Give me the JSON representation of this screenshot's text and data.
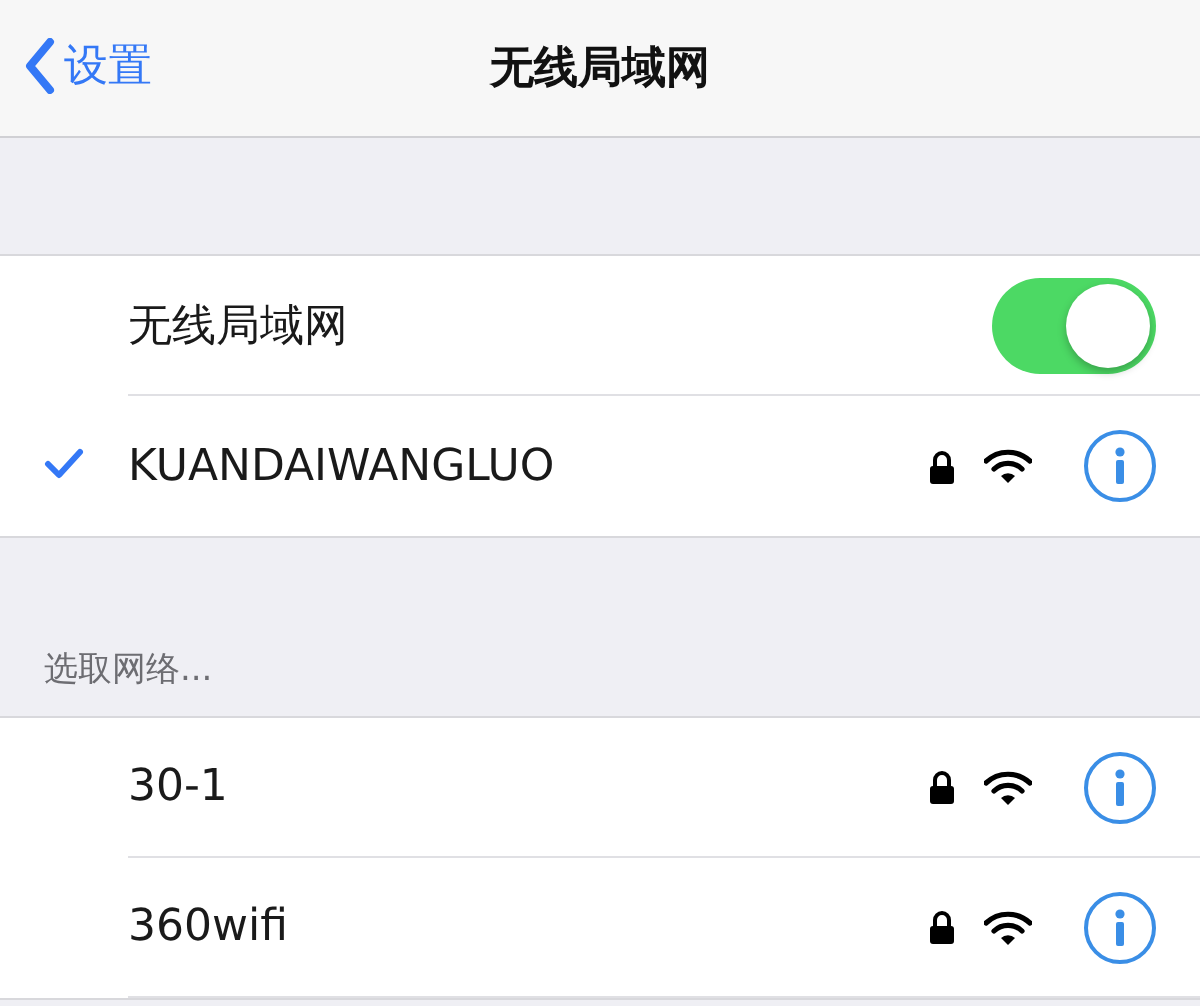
{
  "nav": {
    "back": "设置",
    "title": "无线局域网"
  },
  "wifi": {
    "label": "无线局域网",
    "on": true
  },
  "current_network": {
    "name": "KUANDAIWANGLUO",
    "connected": true,
    "locked": true
  },
  "networks_header": "选取网络...",
  "networks": [
    {
      "name": "30-1",
      "locked": true
    },
    {
      "name": "360wifi",
      "locked": true
    }
  ]
}
